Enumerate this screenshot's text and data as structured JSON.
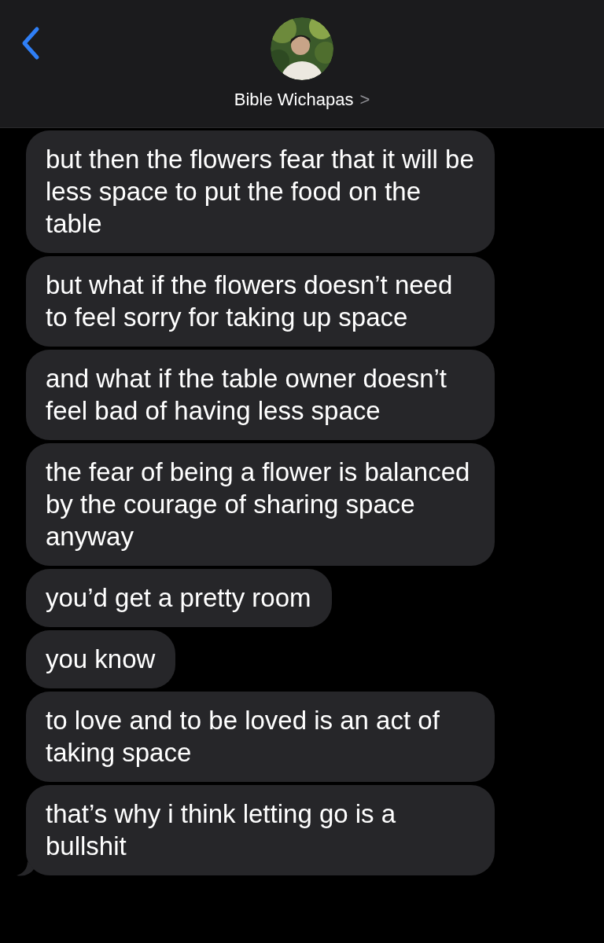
{
  "header": {
    "contact_name": "Bible Wichapas",
    "chevron": ">"
  },
  "messages": [
    {
      "text": "but then the flowers fear that it will be less space to put the food on the table",
      "tail": false
    },
    {
      "text": "but what if the flowers doesn’t need to feel sorry for taking up space",
      "tail": false
    },
    {
      "text": "and what if the table owner doesn’t feel bad of having less space",
      "tail": false
    },
    {
      "text": "the fear of being a flower is balanced by the courage of sharing space anyway",
      "tail": false
    },
    {
      "text": "you’d get a pretty room",
      "tail": false
    },
    {
      "text": "you know",
      "tail": false
    },
    {
      "text": "to love and to be loved is an act of taking space",
      "tail": false
    },
    {
      "text": "that’s why i think letting go is a bullshit",
      "tail": true
    }
  ]
}
